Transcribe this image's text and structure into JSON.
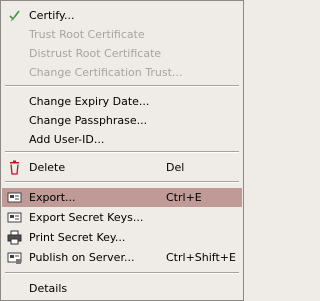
{
  "menu": {
    "certify": "Certify...",
    "trust_root": "Trust Root Certificate",
    "distrust_root": "Distrust Root Certificate",
    "change_trust": "Change Certification Trust...",
    "change_expiry": "Change Expiry Date...",
    "change_passphrase": "Change Passphrase...",
    "add_user_id": "Add User-ID...",
    "delete": "Delete",
    "delete_shortcut": "Del",
    "export": "Export...",
    "export_shortcut": "Ctrl+E",
    "export_secret": "Export Secret Keys...",
    "print_secret": "Print Secret Key...",
    "publish": "Publish on Server...",
    "publish_shortcut": "Ctrl+Shift+E",
    "details": "Details"
  },
  "colors": {
    "highlight": "#bf9a97",
    "disabled_text": "#a8a49c",
    "delete_icon": "#c8102e"
  }
}
